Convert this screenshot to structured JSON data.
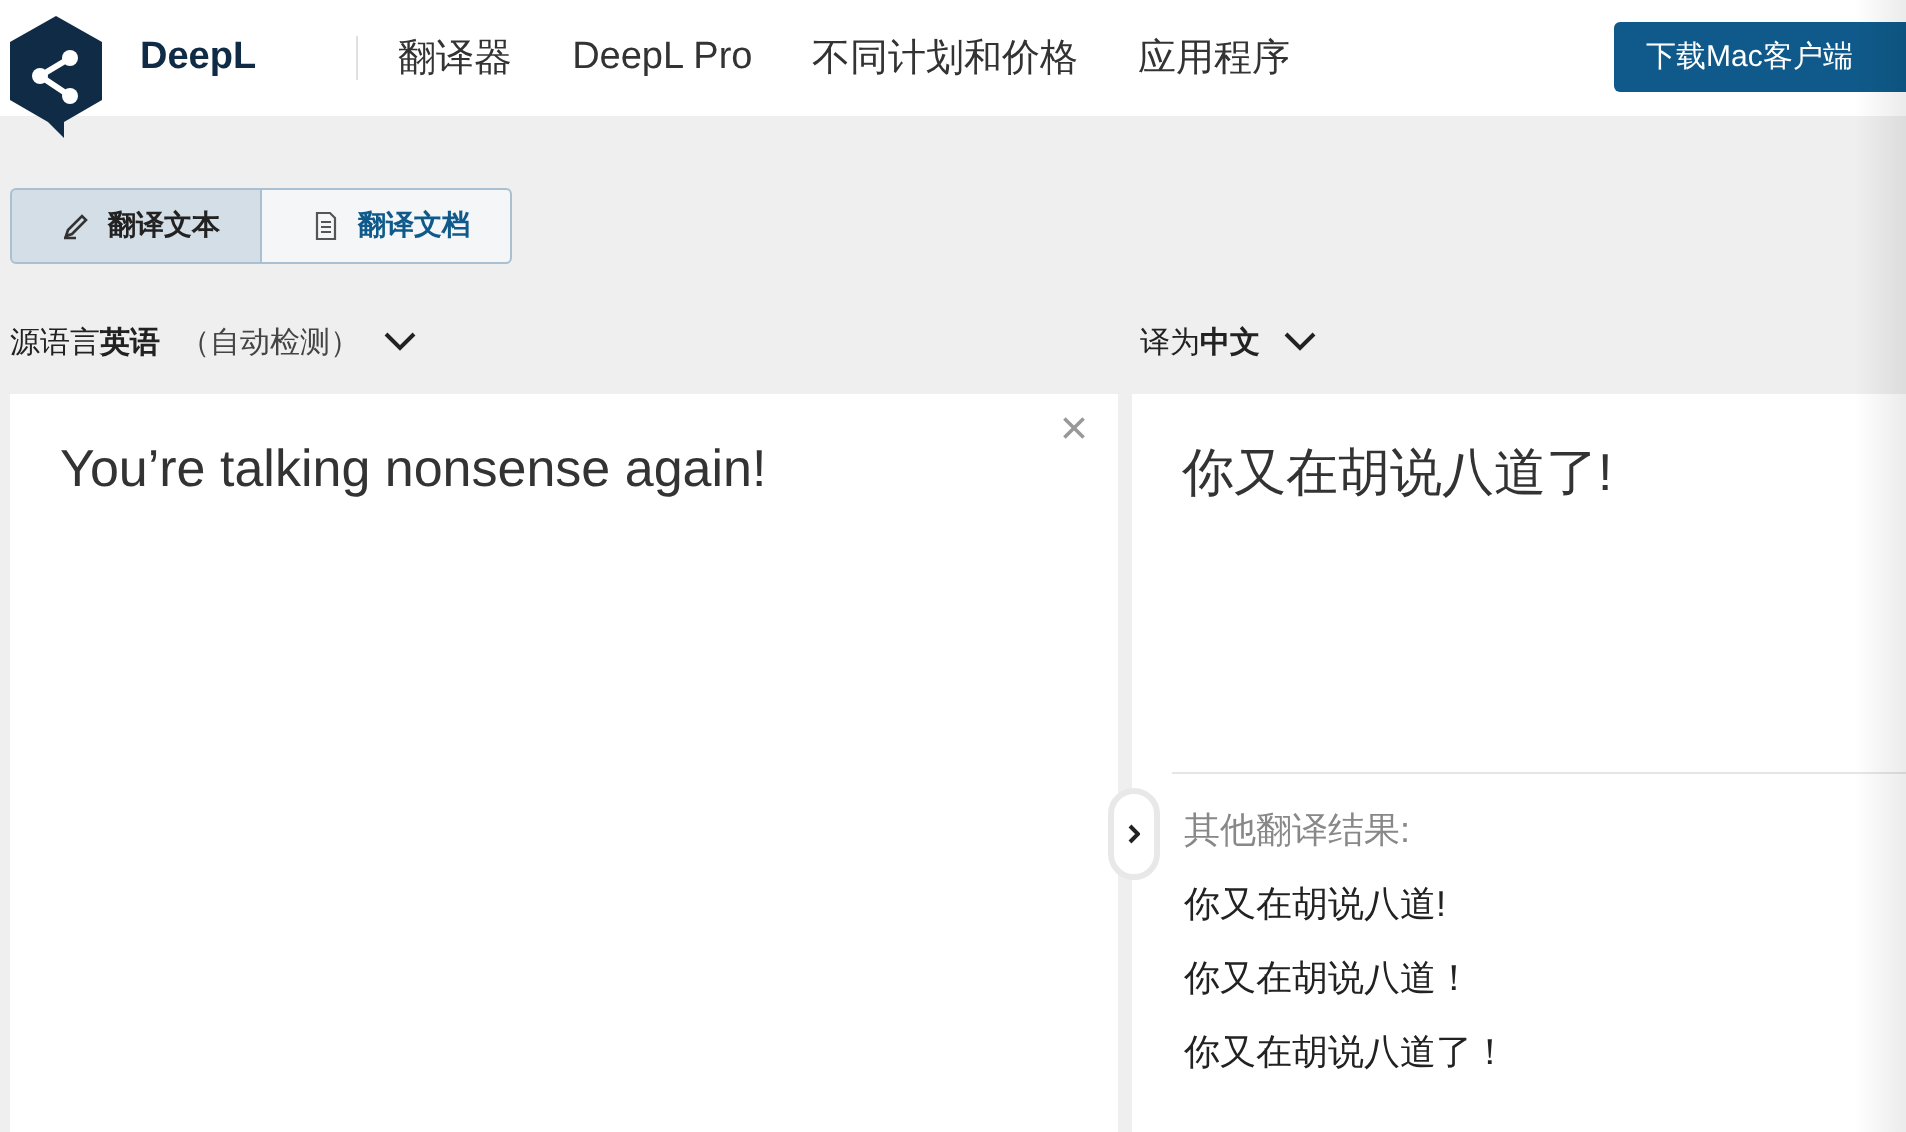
{
  "header": {
    "brand": "DeepL",
    "nav": [
      {
        "label": "翻译器"
      },
      {
        "label": "DeepL Pro"
      },
      {
        "label": "不同计划和价格"
      },
      {
        "label": "应用程序"
      }
    ],
    "download_button": "下载Mac客户端"
  },
  "mode_tabs": [
    {
      "label": "翻译文本",
      "kind": "text",
      "selected": true
    },
    {
      "label": "翻译文档",
      "kind": "document",
      "selected": false
    }
  ],
  "source": {
    "prefix": "源语言",
    "language": "英语",
    "detected": "（自动检测）",
    "text": "You’re talking nonsense again!"
  },
  "target": {
    "prefix": "译为",
    "language": "中文",
    "text": "你又在胡说八道了!",
    "alternatives_title": "其他翻译结果:",
    "alternatives": [
      "你又在胡说八道!",
      "你又在胡说八道！",
      "你又在胡说八道了！"
    ]
  }
}
